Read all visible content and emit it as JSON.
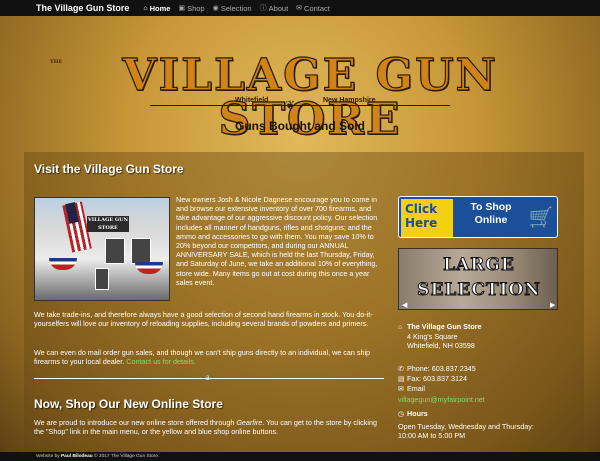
{
  "nav": {
    "brand": "The Village Gun Store",
    "items": [
      {
        "icon": "home-icon",
        "glyph": "⌂",
        "label": "Home"
      },
      {
        "icon": "shop-icon",
        "glyph": "▣",
        "label": "Shop"
      },
      {
        "icon": "selection-icon",
        "glyph": "◉",
        "label": "Selection"
      },
      {
        "icon": "about-icon",
        "glyph": "ⓘ",
        "label": "About"
      },
      {
        "icon": "contact-icon",
        "glyph": "✉",
        "label": "Contact"
      }
    ]
  },
  "header": {
    "the": "THE",
    "title": "VILLAGE GUN STORE",
    "town": "Whitefield",
    "state": "New Hampshire",
    "tagline": "Guns Bought and Sold"
  },
  "visit": {
    "title": "Visit the Village Gun Store",
    "sign": "VILLAGE GUN STORE",
    "intro": "New owners Josh & Nicole Dagnese encourage you to come in and browse our extensive inventory of over 700 firearms, and take advantage of our aggressive discount policy. Our selection includes all manner of handguns, rifles and shotguns; and the ammo and accessories to go with them. You may save 10% to 20% beyond our competitors, and during our ANNUAL ANNIVERSARY SALE, which is held the last Thursday, Friday, and Saturday of June, we take an additional 10% of everything, store wide. Many items go out at cost during this once a year sales event.",
    "para2": "We take trade-ins, and therefore always have a good selection of second hand firearms in stock. You do-it-yourselfers will love our inventory of reloading supplies, including several brands of powders and primers.",
    "para3": "We can even do mail order gun sales, and though we can't ship guns directly to an individual, we can ship firearms to your local dealer.",
    "para3_link": "Contact us for details."
  },
  "shop": {
    "title": "Now, Shop Our New Online Store",
    "text_before": "We are proud to introduce our new online store offered through",
    "text_italic": "Gearfire",
    "text_after": ". You can get to the store by clicking the \"Shop\" link in the main menu, or the yellow and blue shop online buttons."
  },
  "banner": {
    "click_line1": "Click",
    "click_line2": "Here",
    "shop_line1": "To Shop",
    "shop_line2": "Online"
  },
  "slider": {
    "line1": "LARGE",
    "line2": "SELECTION"
  },
  "contact": {
    "name": "The Village Gun Store",
    "street": "4 King's Square",
    "city": "Whitefield, NH 03598",
    "phone": "Phone: 603.837.2345",
    "fax": "Fax: 603.837.3124",
    "email_label": "Email",
    "email": "villagegun@myfairpoint.net",
    "hours_label": "Hours",
    "hours_line1": "Open Tuesday, Wednesday and Thursday:",
    "hours_line2": "10:00 AM to 5:00 PM"
  },
  "footer": {
    "prefix": "Website by",
    "author": "Paul Bilodeau",
    "copyright": "© 2017 The Village Gun Store."
  }
}
